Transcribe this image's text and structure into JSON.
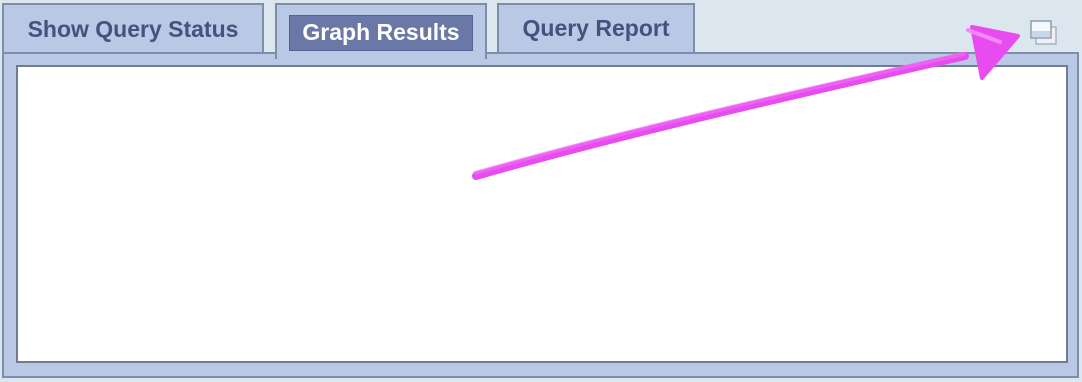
{
  "tabs": [
    {
      "id": "status",
      "label": "Show Query Status"
    },
    {
      "id": "graph",
      "label": "Graph Results",
      "active": true
    },
    {
      "id": "report",
      "label": "Query Report"
    }
  ],
  "icons": {
    "maximize": "maximize-window-icon",
    "annotation": "magenta-arrow-annotation"
  },
  "colors": {
    "background": "#dce6ee",
    "tab": "#b9c8e4",
    "active_tab": "#6a78a8",
    "tab_text": "#44527e",
    "annotation": "#e84cf0"
  }
}
